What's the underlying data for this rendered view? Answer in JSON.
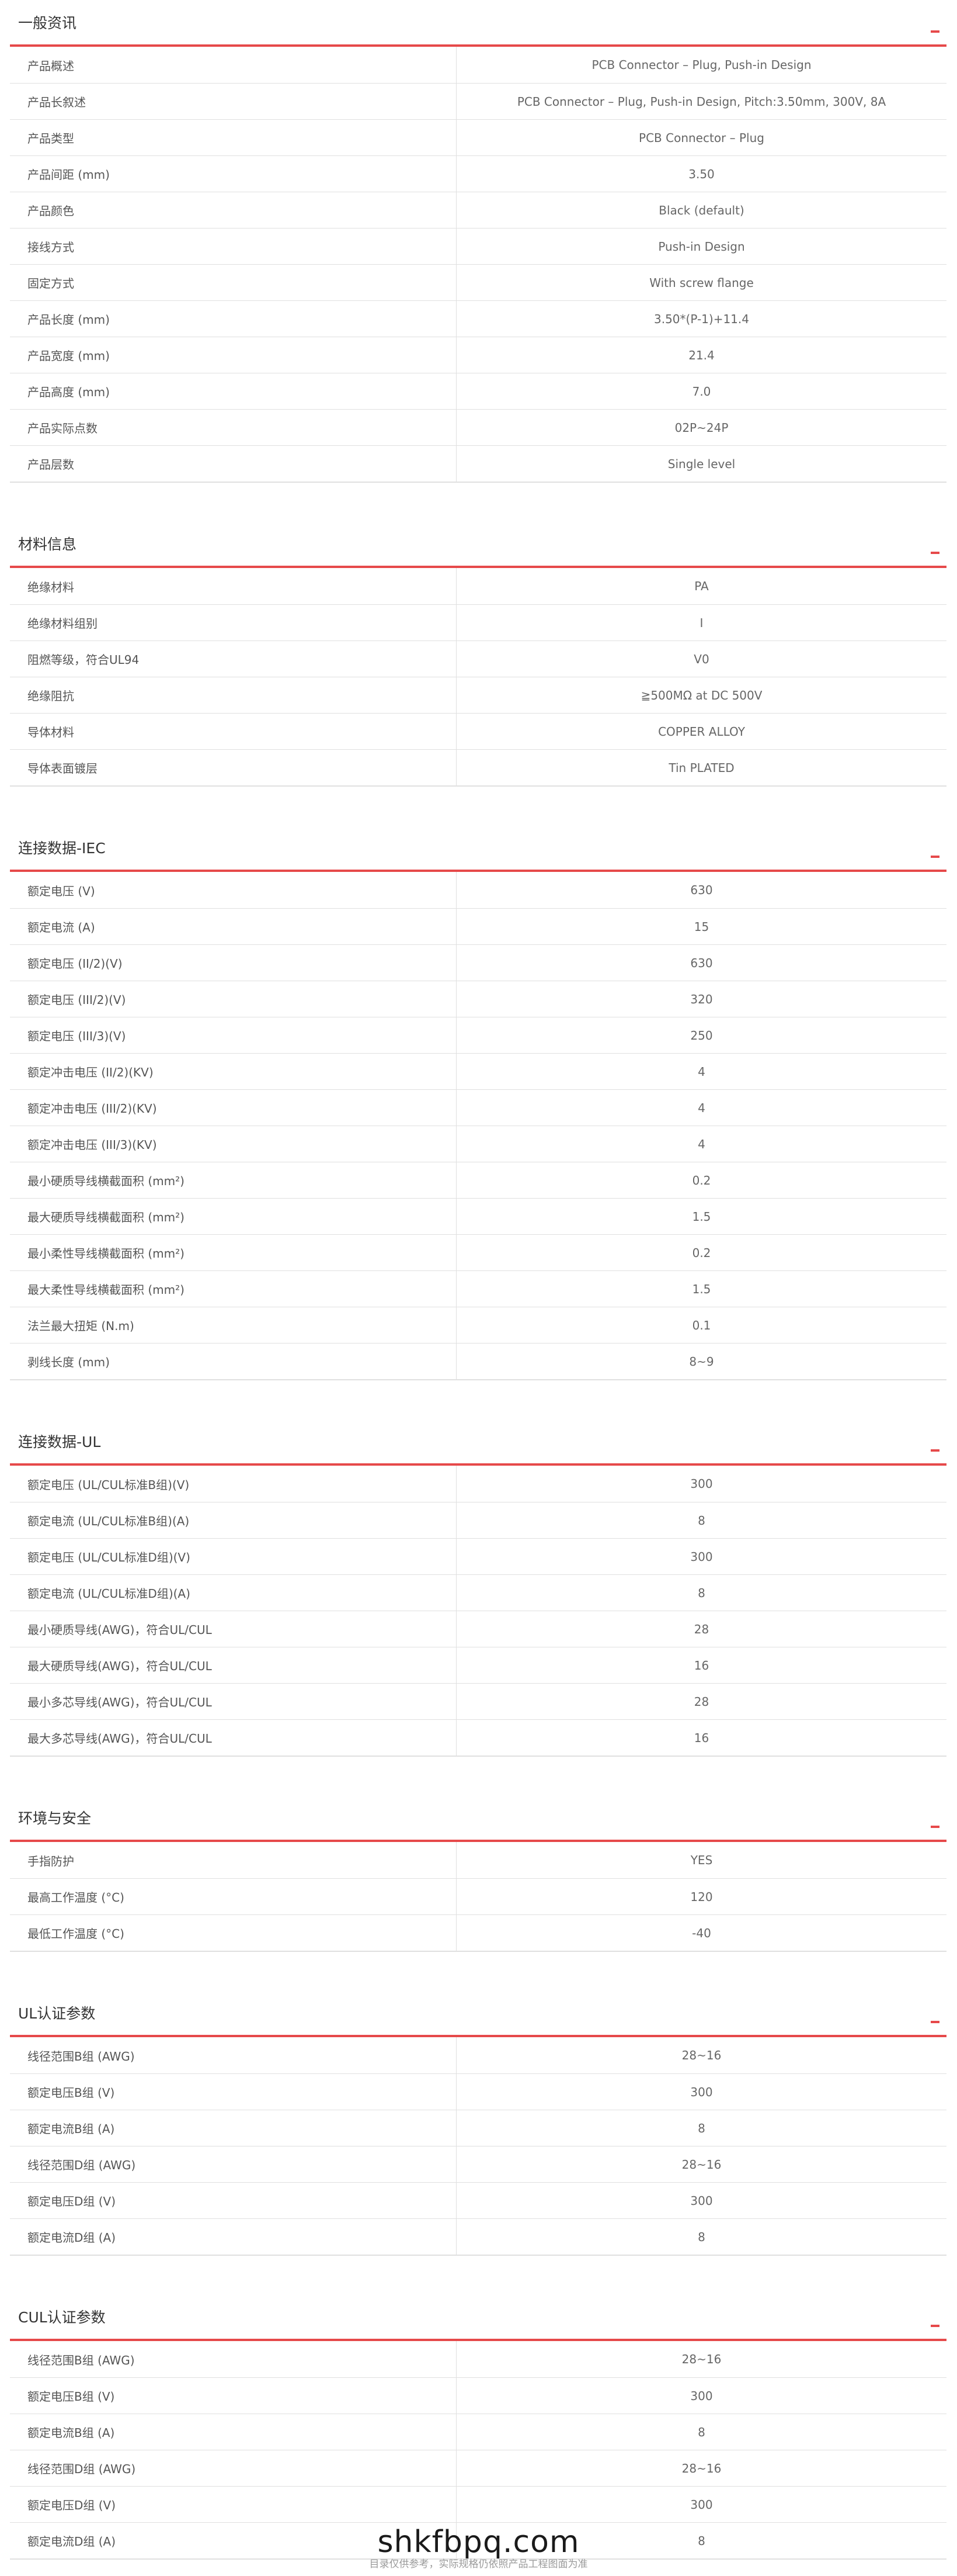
{
  "sections": [
    {
      "title": "一般资讯",
      "rows": [
        {
          "label": "产品概述",
          "value": "PCB Connector – Plug, Push-in Design"
        },
        {
          "label": "产品长叙述",
          "value": "PCB Connector – Plug, Push-in Design, Pitch:3.50mm, 300V, 8A"
        },
        {
          "label": "产品类型",
          "value": "PCB Connector – Plug"
        },
        {
          "label": "产品间距 (mm)",
          "value": "3.50"
        },
        {
          "label": "产品颜色",
          "value": "Black (default)"
        },
        {
          "label": "接线方式",
          "value": "Push-in Design"
        },
        {
          "label": "固定方式",
          "value": "With screw flange"
        },
        {
          "label": "产品长度 (mm)",
          "value": "3.50*(P-1)+11.4"
        },
        {
          "label": "产品宽度 (mm)",
          "value": "21.4"
        },
        {
          "label": "产品高度 (mm)",
          "value": "7.0"
        },
        {
          "label": "产品实际点数",
          "value": "02P~24P"
        },
        {
          "label": "产品层数",
          "value": "Single level"
        }
      ]
    },
    {
      "title": "材料信息",
      "rows": [
        {
          "label": "绝缘材料",
          "value": "PA"
        },
        {
          "label": "绝缘材料组别",
          "value": "I"
        },
        {
          "label": "阻燃等级，符合UL94",
          "value": "V0"
        },
        {
          "label": "绝缘阻抗",
          "value": "≧500MΩ at DC 500V"
        },
        {
          "label": "导体材料",
          "value": "COPPER ALLOY"
        },
        {
          "label": "导体表面镀层",
          "value": "Tin PLATED"
        }
      ]
    },
    {
      "title": "连接数据-IEC",
      "rows": [
        {
          "label": "额定电压 (V)",
          "value": "630"
        },
        {
          "label": "额定电流 (A)",
          "value": "15"
        },
        {
          "label": "额定电压 (II/2)(V)",
          "value": "630"
        },
        {
          "label": "额定电压 (III/2)(V)",
          "value": "320"
        },
        {
          "label": "额定电压 (III/3)(V)",
          "value": "250"
        },
        {
          "label": "额定冲击电压 (II/2)(KV)",
          "value": "4"
        },
        {
          "label": "额定冲击电压 (III/2)(KV)",
          "value": "4"
        },
        {
          "label": "额定冲击电压 (III/3)(KV)",
          "value": "4"
        },
        {
          "label": "最小硬质导线横截面积 (mm²)",
          "value": "0.2"
        },
        {
          "label": "最大硬质导线横截面积 (mm²)",
          "value": "1.5"
        },
        {
          "label": "最小柔性导线横截面积 (mm²)",
          "value": "0.2"
        },
        {
          "label": "最大柔性导线横截面积 (mm²)",
          "value": "1.5"
        },
        {
          "label": "法兰最大扭矩 (N.m)",
          "value": "0.1"
        },
        {
          "label": "剥线长度 (mm)",
          "value": "8~9"
        }
      ]
    },
    {
      "title": "连接数据-UL",
      "rows": [
        {
          "label": "额定电压 (UL/CUL标准B组)(V)",
          "value": "300"
        },
        {
          "label": "额定电流 (UL/CUL标准B组)(A)",
          "value": "8"
        },
        {
          "label": "额定电压 (UL/CUL标准D组)(V)",
          "value": "300"
        },
        {
          "label": "额定电流 (UL/CUL标准D组)(A)",
          "value": "8"
        },
        {
          "label": "最小硬质导线(AWG)，符合UL/CUL",
          "value": "28"
        },
        {
          "label": "最大硬质导线(AWG)，符合UL/CUL",
          "value": "16"
        },
        {
          "label": "最小多芯导线(AWG)，符合UL/CUL",
          "value": "28"
        },
        {
          "label": "最大多芯导线(AWG)，符合UL/CUL",
          "value": "16"
        }
      ]
    },
    {
      "title": "环境与安全",
      "rows": [
        {
          "label": "手指防护",
          "value": "YES"
        },
        {
          "label": "最高工作温度 (°C)",
          "value": "120"
        },
        {
          "label": "最低工作温度 (°C)",
          "value": "-40"
        }
      ]
    },
    {
      "title": "UL认证参数",
      "rows": [
        {
          "label": "线径范围B组 (AWG)",
          "value": "28~16"
        },
        {
          "label": "额定电压B组 (V)",
          "value": "300"
        },
        {
          "label": "额定电流B组 (A)",
          "value": "8"
        },
        {
          "label": "线径范围D组 (AWG)",
          "value": "28~16"
        },
        {
          "label": "额定电压D组 (V)",
          "value": "300"
        },
        {
          "label": "额定电流D组 (A)",
          "value": "8"
        }
      ]
    },
    {
      "title": "CUL认证参数",
      "rows": [
        {
          "label": "线径范围B组 (AWG)",
          "value": "28~16"
        },
        {
          "label": "额定电压B组 (V)",
          "value": "300"
        },
        {
          "label": "额定电流B组 (A)",
          "value": "8"
        },
        {
          "label": "线径范围D组 (AWG)",
          "value": "28~16"
        },
        {
          "label": "额定电压D组 (V)",
          "value": "300"
        },
        {
          "label": "额定电流D组 (A)",
          "value": "8"
        }
      ]
    }
  ],
  "icons": {
    "collapse": "minus-icon"
  },
  "colors": {
    "accent": "#e6494a",
    "border": "#e0e0e0"
  },
  "footer": {
    "watermark": "shkfbpq.com",
    "note": "目录仅供参考，实际规格仍依照产品工程图面为准"
  }
}
